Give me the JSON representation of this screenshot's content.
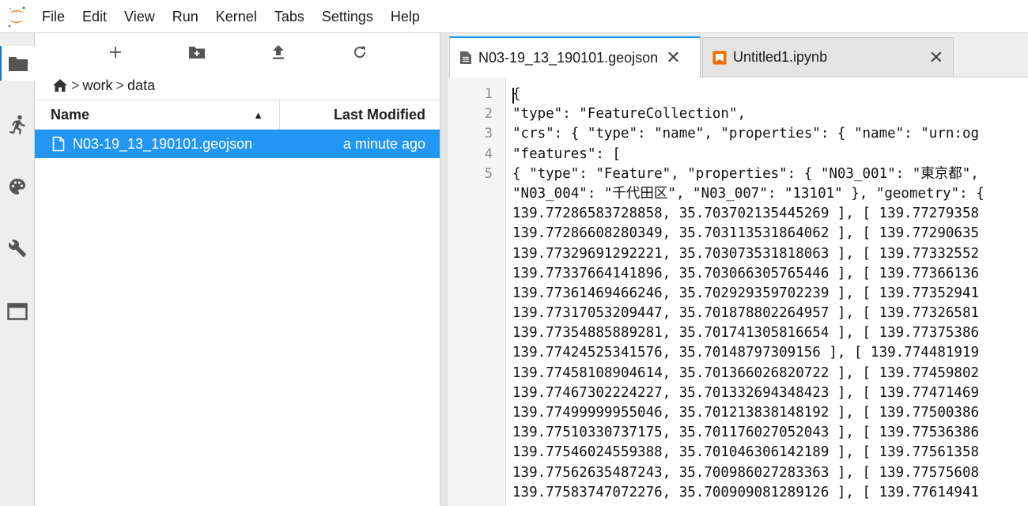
{
  "menubar": {
    "items": [
      "File",
      "Edit",
      "View",
      "Run",
      "Kernel",
      "Tabs",
      "Settings",
      "Help"
    ]
  },
  "activitybar": {
    "items": [
      "folder-icon",
      "running-icon",
      "palette-icon",
      "wrench-icon",
      "tabs-icon"
    ]
  },
  "filebrowser": {
    "toolbar": [
      "new-launcher-icon",
      "new-folder-icon",
      "upload-icon",
      "refresh-icon"
    ],
    "breadcrumb": {
      "segments": [
        "work",
        "data"
      ],
      "separator": ">"
    },
    "header": {
      "name": "Name",
      "modified": "Last Modified",
      "sort_indicator": "▲"
    },
    "files": [
      {
        "name": "N03-19_13_190101.geojson",
        "modified": "a minute ago",
        "selected": true
      }
    ]
  },
  "tabs": [
    {
      "label": "N03-19_13_190101.geojson",
      "close": "✕",
      "active": true,
      "icon": "text-file-icon"
    },
    {
      "label": "Untitled1.ipynb",
      "close": "✕",
      "active": false,
      "icon": "notebook-icon"
    }
  ],
  "editor": {
    "line_numbers": [
      "1",
      "2",
      "3",
      "4",
      "5",
      "",
      "",
      "",
      "",
      "",
      "",
      "",
      "",
      "",
      "",
      "",
      "",
      "",
      "",
      "",
      ""
    ],
    "lines": [
      "{",
      "\"type\": \"FeatureCollection\",",
      "\"crs\": { \"type\": \"name\", \"properties\": { \"name\": \"urn:og",
      "\"features\": [",
      "{ \"type\": \"Feature\", \"properties\": { \"N03_001\": \"東京都\",",
      "\"N03_004\": \"千代田区\", \"N03_007\": \"13101\" }, \"geometry\": {",
      "139.77286583728858, 35.703702135445269 ], [ 139.77279358",
      "139.77286608280349, 35.703113531864062 ], [ 139.77290635",
      "139.77329691292221, 35.703073531818063 ], [ 139.77332552",
      "139.77337664141896, 35.703066305765446 ], [ 139.77366136",
      "139.77361469466246, 35.702929359702239 ], [ 139.77352941",
      "139.77317053209447, 35.701878802264957 ], [ 139.77326581",
      "139.77354885889281, 35.701741305816654 ], [ 139.77375386",
      "139.77424525341576, 35.70148797309156 ], [ 139.774481919",
      "139.77458108904614, 35.701366026820722 ], [ 139.77459802",
      "139.77467302224227, 35.701332694348423 ], [ 139.77471469",
      "139.77499999955046, 35.701213838148192 ], [ 139.77500386",
      "139.77510330737175, 35.701176027052043 ], [ 139.77536386",
      "139.77546024559388, 35.701046306142189 ], [ 139.77561358",
      "139.77562635487243, 35.700986027283363 ], [ 139.77575608",
      "139.77583747072276, 35.700909081289126 ], [ 139.77614941"
    ]
  },
  "colors": {
    "accent": "#2196f3",
    "selection_text": "#ffffff",
    "jupyter_orange": "#f37626"
  }
}
